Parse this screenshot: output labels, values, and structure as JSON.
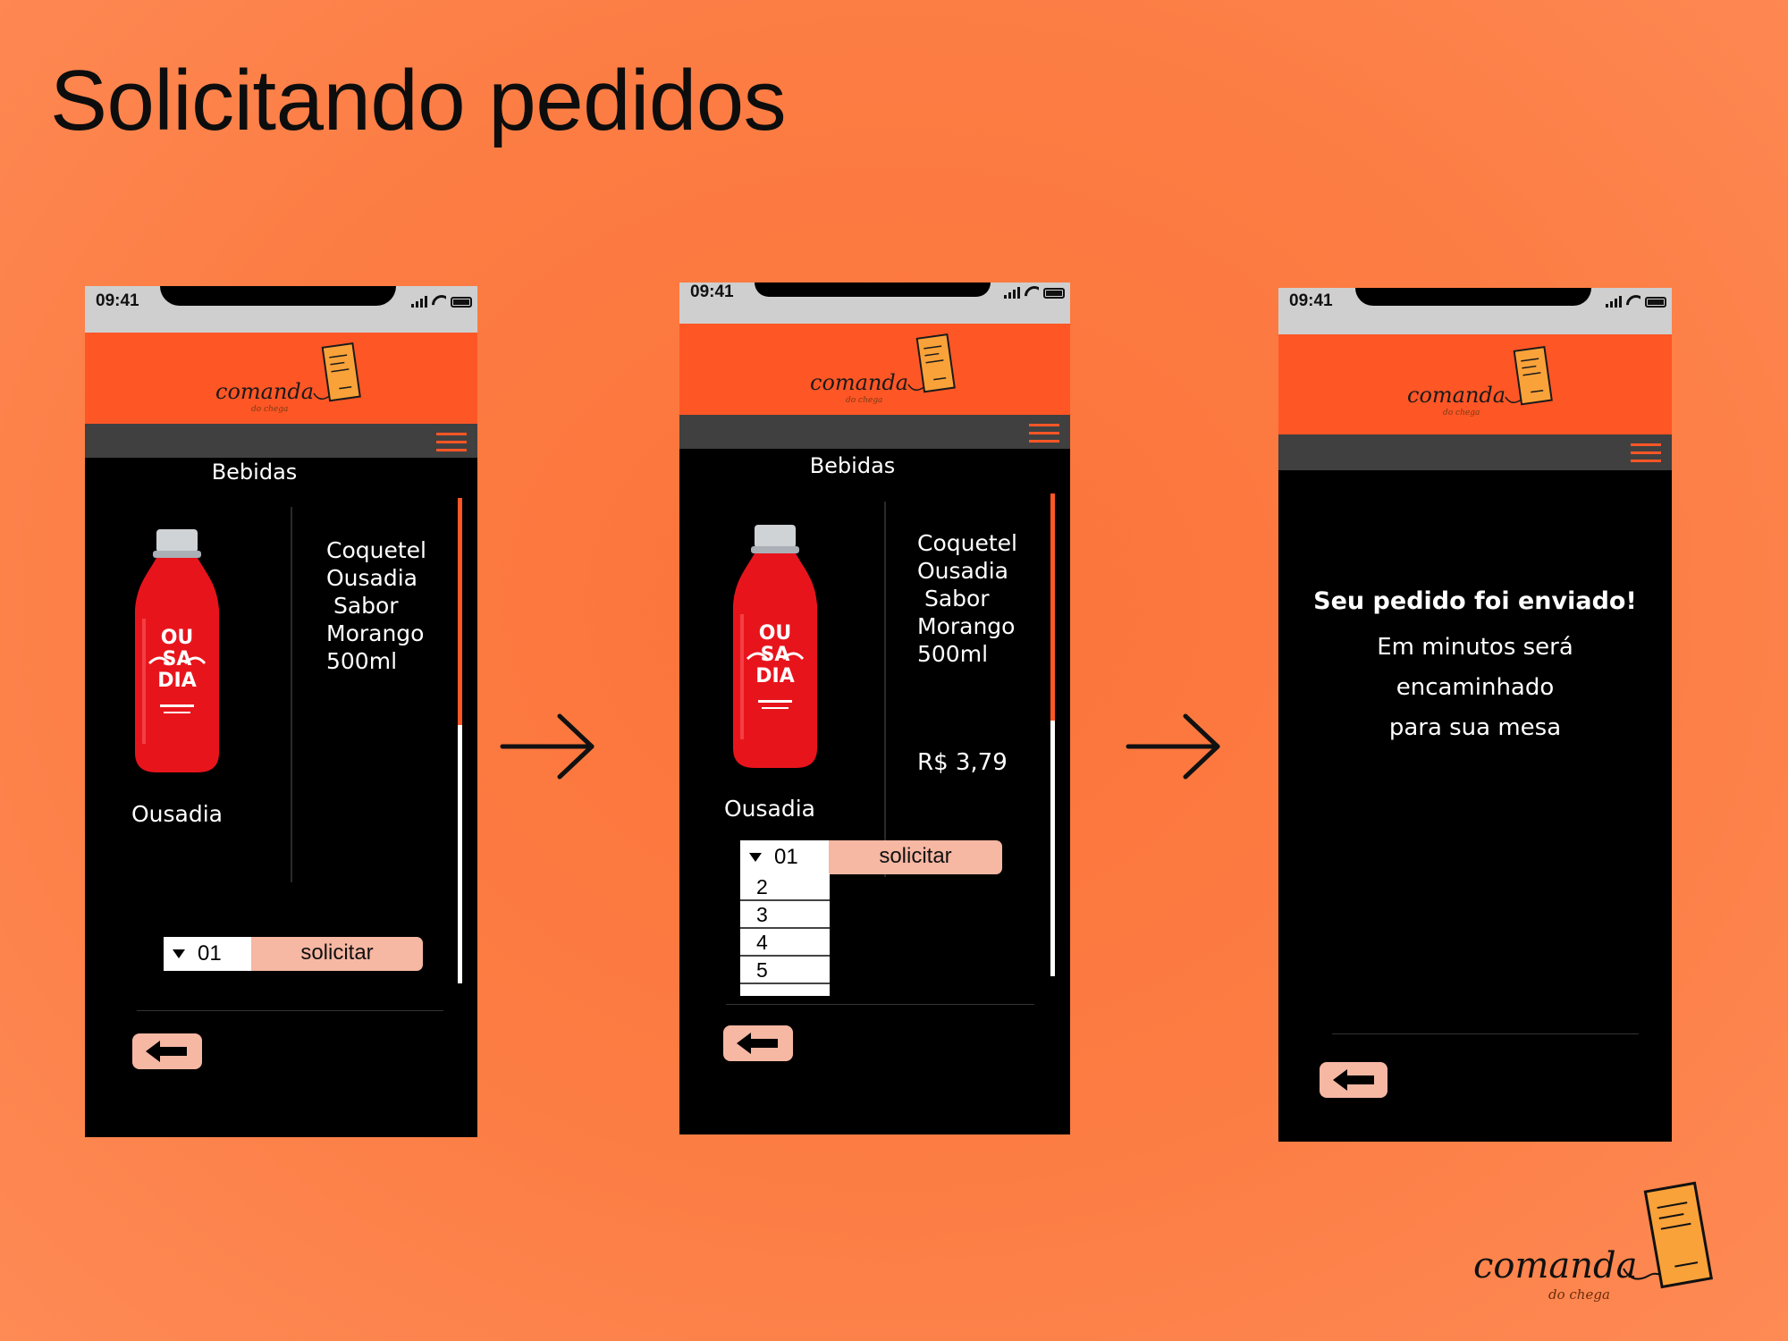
{
  "page": {
    "title": "Solicitando pedidos"
  },
  "status_bar": {
    "time": "09:41"
  },
  "brand": {
    "logo_text": "comanda",
    "logo_subtext": "do chega"
  },
  "menu": {
    "section": "Bebidas"
  },
  "product": {
    "name": "Ousadia",
    "description_lines": [
      "Coquetel",
      "Ousadia",
      " Sabor",
      "Morango",
      "500ml"
    ],
    "price": "R$ 3,79",
    "bottle_label": "OU SA DIA"
  },
  "order": {
    "quantity": "01",
    "request_label": "solicitar",
    "quantity_options": [
      "2",
      "3",
      "4",
      "5"
    ]
  },
  "confirmation": {
    "title": "Seu pedido foi enviado!",
    "lines": [
      "Em minutos será",
      "encaminhado",
      "para sua mesa"
    ]
  },
  "colors": {
    "background": "#fc7d44",
    "brand_orange": "#ff5626",
    "button_pink": "#f6b7a3",
    "nav_gray": "#404040",
    "status_gray": "#cfcfcf"
  },
  "icons": [
    "signal-icon",
    "wifi-icon",
    "battery-icon",
    "menu-icon",
    "back-arrow-icon",
    "flow-arrow-icon",
    "receipt-icon"
  ]
}
